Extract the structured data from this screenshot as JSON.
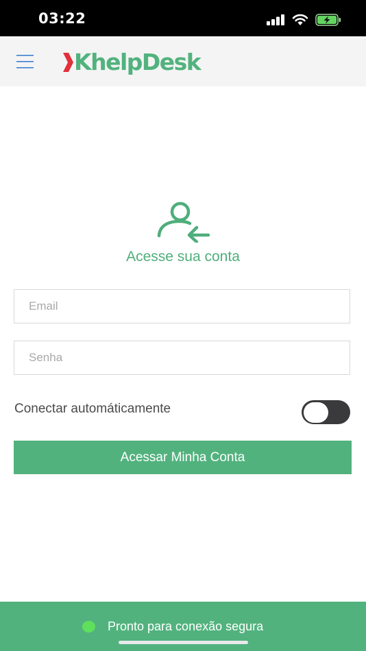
{
  "status_bar": {
    "time": "03:22"
  },
  "header": {
    "logo_text": "KhelpDesk",
    "menu_icon": "hamburger-menu-icon"
  },
  "login": {
    "icon": "user-login-arrow-icon",
    "title": "Acesse sua conta",
    "email_placeholder": "Email",
    "email_value": "",
    "password_placeholder": "Senha",
    "password_value": "",
    "auto_connect_label": "Conectar automáticamente",
    "auto_connect_enabled": false,
    "submit_label": "Acessar Minha Conta"
  },
  "footer": {
    "status_text": "Pronto para conexão segura",
    "status_color": "#5fe05d"
  },
  "colors": {
    "brand_green": "#52b27e",
    "logo_red": "#e2303c",
    "menu_blue": "#3b7fd1"
  }
}
